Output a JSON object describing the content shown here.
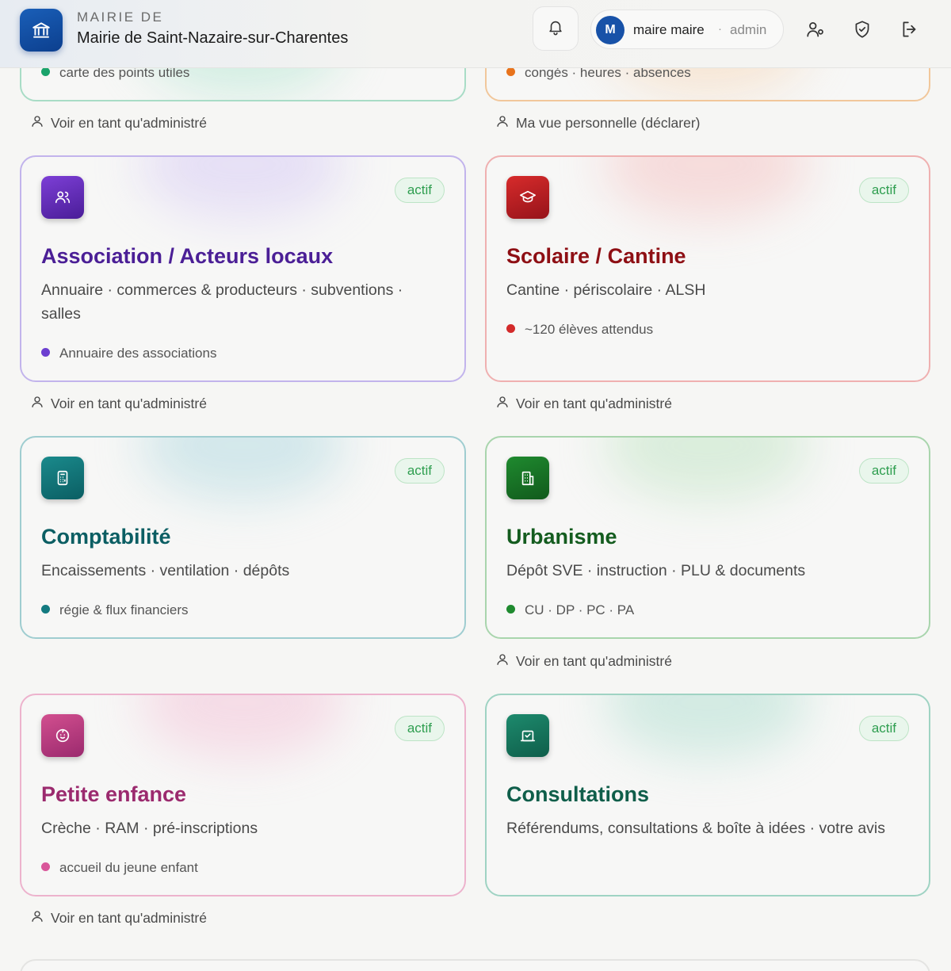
{
  "header": {
    "kicker": "MAIRIE DE",
    "name": "Mairie de Saint-Nazaire-sur-Charentes",
    "user": {
      "initial": "M",
      "name": "maire maire",
      "separator": "·",
      "role": "admin"
    },
    "icons": [
      "bell-icon",
      "user-settings-icon",
      "shield-check-icon",
      "logout-icon"
    ]
  },
  "partial_cards": [
    {
      "note": "carte des points utiles",
      "dot_color": "#1aa36b",
      "view_label": "Voir en tant qu'administré"
    },
    {
      "note": "congés · heures · absences",
      "dot_color": "#e8731c",
      "view_label": "Ma vue personnelle (déclarer)"
    }
  ],
  "cards": [
    {
      "title": "Association / Acteurs locaux",
      "description": "Annuaire · commerces & producteurs · subventions · salles",
      "note": "Annuaire des associations",
      "badge": "actif",
      "icon": "users-icon",
      "accent": "#4b1f96",
      "view_label": "Voir en tant qu'administré"
    },
    {
      "title": "Scolaire / Cantine",
      "description": "Cantine · périscolaire · ALSH",
      "note": "~120 élèves attendus",
      "badge": "actif",
      "icon": "graduation-cap-icon",
      "accent": "#8e0f14",
      "view_label": "Voir en tant qu'administré"
    },
    {
      "title": "Comptabilité",
      "description": "Encaissements · ventilation · dépôts",
      "note": "régie & flux financiers",
      "badge": "actif",
      "icon": "calculator-icon",
      "accent": "#0b5e63"
    },
    {
      "title": "Urbanisme",
      "description": "Dépôt SVE · instruction · PLU & documents",
      "note": "CU · DP · PC · PA",
      "badge": "actif",
      "icon": "building-icon",
      "accent": "#145c1f",
      "view_label": "Voir en tant qu'administré"
    },
    {
      "title": "Petite enfance",
      "description": "Crèche · RAM · pré-inscriptions",
      "note": "accueil du jeune enfant",
      "badge": "actif",
      "icon": "baby-icon",
      "accent": "#9b2a6e",
      "view_label": "Voir en tant qu'administré"
    },
    {
      "title": "Consultations",
      "description": "Référendums, consultations & boîte à idées · votre avis",
      "badge": "actif",
      "icon": "vote-box-icon",
      "accent": "#0f5e4a"
    }
  ]
}
